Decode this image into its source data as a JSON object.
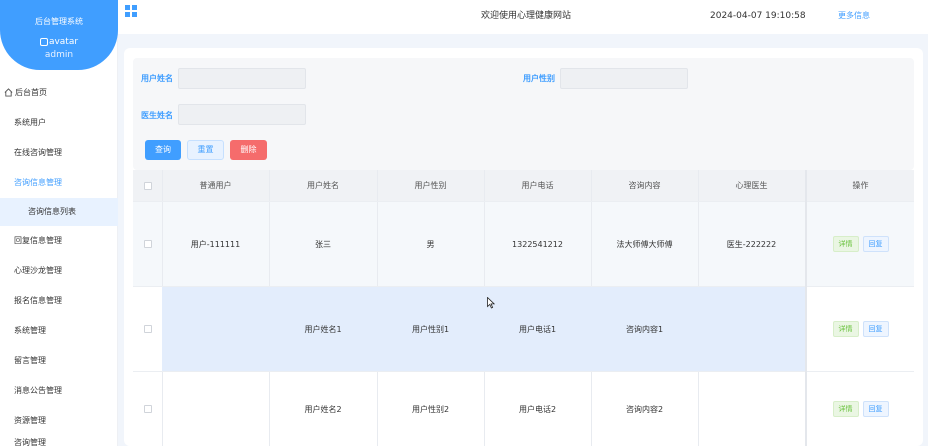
{
  "sidebar": {
    "system_name": "后台管理系统",
    "avatar_alt": "avatar",
    "username": "admin",
    "menu": [
      "后台首页",
      "系统用户",
      "在线咨询管理",
      "咨询信息管理",
      "咨询信息列表",
      "回复信息管理",
      "心理沙龙管理",
      "报名信息管理",
      "系统管理",
      "留言管理",
      "消息公告管理",
      "资源管理",
      "咨询管理"
    ]
  },
  "header": {
    "welcome": "欢迎使用心理健康网站",
    "datetime": "2024-04-07 19:10:58",
    "more": "更多信息"
  },
  "search": {
    "user_name_label": "用户姓名",
    "user_gender_label": "用户性别",
    "doctor_name_label": "医生姓名",
    "user_name_value": "",
    "user_gender_value": "",
    "doctor_name_value": "",
    "query_label": "查询",
    "reset_label": "重置",
    "delete_label": "删除"
  },
  "table": {
    "columns": [
      "普通用户",
      "用户姓名",
      "用户性别",
      "用户电话",
      "咨询内容",
      "心理医生",
      "操作"
    ],
    "rows": [
      [
        "用户-111111",
        "张三",
        "男",
        "1322541212",
        "法大师傅大师傅",
        "医生-222222"
      ],
      [
        "",
        "用户姓名1",
        "用户性别1",
        "用户电话1",
        "咨询内容1",
        ""
      ],
      [
        "",
        "用户姓名2",
        "用户性别2",
        "用户电话2",
        "咨询内容2",
        ""
      ]
    ],
    "detail_label": "详情",
    "reply_label": "回复"
  },
  "colors": {
    "accent": "#409eff",
    "danger": "#f56c6c",
    "success": "#67c23a"
  }
}
